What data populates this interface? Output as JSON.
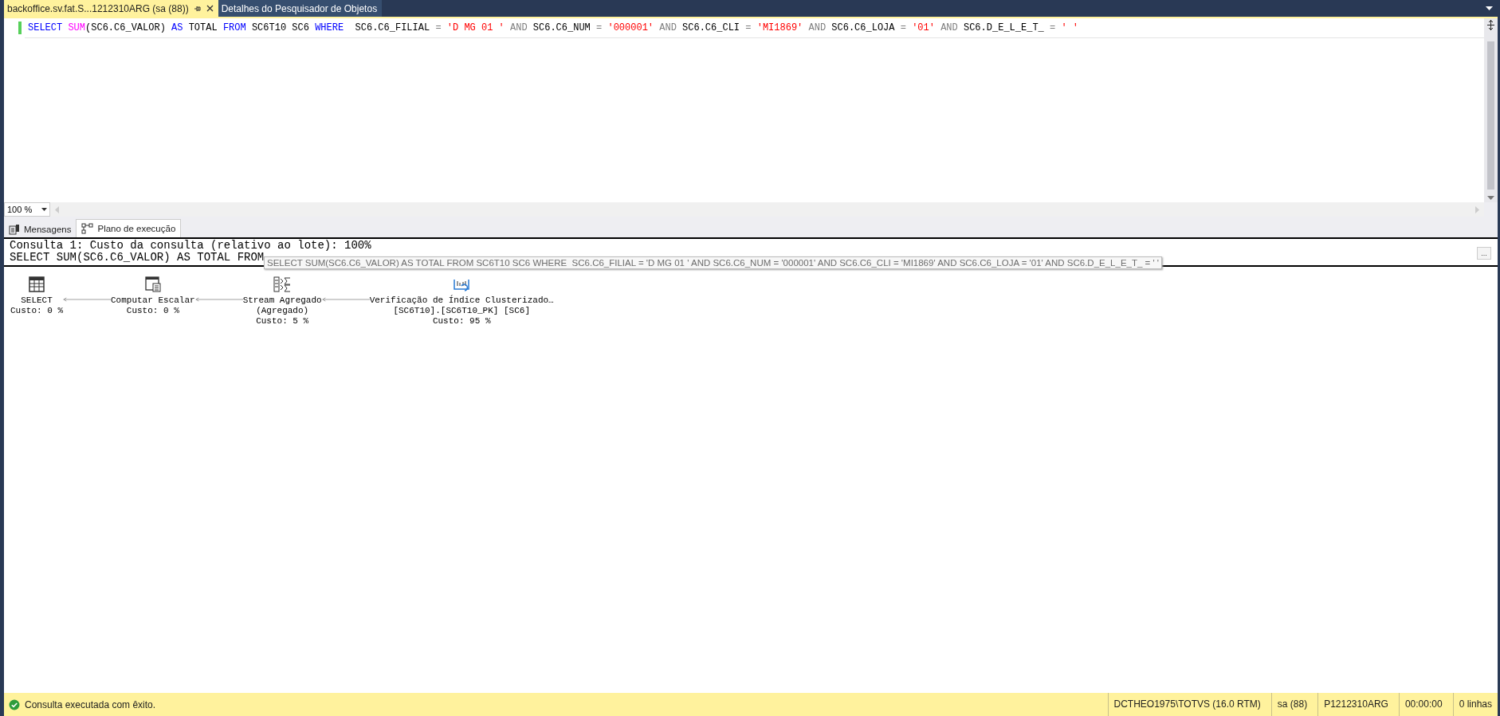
{
  "tabs": [
    {
      "label": "backoffice.sv.fat.S...1212310ARG (sa (88))",
      "selected": true
    },
    {
      "label": "Detalhes do Pesquisador de Objetos",
      "selected": false
    }
  ],
  "editor": {
    "tokens": [
      {
        "text": "SELECT ",
        "kind": "kw"
      },
      {
        "text": "SUM",
        "kind": "fn"
      },
      {
        "text": "(SC6.C6_VALOR) ",
        "kind": "plain"
      },
      {
        "text": "AS ",
        "kind": "kw"
      },
      {
        "text": "TOTAL ",
        "kind": "plain"
      },
      {
        "text": "FROM ",
        "kind": "kw"
      },
      {
        "text": "SC6T10 SC6 ",
        "kind": "plain"
      },
      {
        "text": "WHERE ",
        "kind": "kw"
      },
      {
        "text": " SC6.C6_FILIAL ",
        "kind": "plain"
      },
      {
        "text": "= ",
        "kind": "op"
      },
      {
        "text": "'D MG 01 '",
        "kind": "str"
      },
      {
        "text": " AND ",
        "kind": "op"
      },
      {
        "text": "SC6.C6_NUM ",
        "kind": "plain"
      },
      {
        "text": "= ",
        "kind": "op"
      },
      {
        "text": "'000001'",
        "kind": "str"
      },
      {
        "text": " AND ",
        "kind": "op"
      },
      {
        "text": "SC6.C6_CLI ",
        "kind": "plain"
      },
      {
        "text": "= ",
        "kind": "op"
      },
      {
        "text": "'MI1869'",
        "kind": "str"
      },
      {
        "text": " AND ",
        "kind": "op"
      },
      {
        "text": "SC6.C6_LOJA ",
        "kind": "plain"
      },
      {
        "text": "= ",
        "kind": "op"
      },
      {
        "text": "'01'",
        "kind": "str"
      },
      {
        "text": " AND ",
        "kind": "op"
      },
      {
        "text": "SC6.D_E_L_E_T_ ",
        "kind": "plain"
      },
      {
        "text": "= ",
        "kind": "op"
      },
      {
        "text": "' '",
        "kind": "str"
      }
    ]
  },
  "zoom": "100 %",
  "result_tabs": [
    {
      "label": "Mensagens",
      "kind": "messages",
      "selected": false
    },
    {
      "label": "Plano de execução",
      "kind": "plan",
      "selected": true
    }
  ],
  "plan": {
    "header": "Consulta 1: Custo da consulta (relativo ao lote): 100%",
    "query": "SELECT SUM(SC6.C6_VALOR) AS TOTAL FROM",
    "tooltip": "SELECT SUM(SC6.C6_VALOR) AS TOTAL FROM SC6T10 SC6 WHERE  SC6.C6_FILIAL = 'D MG 01 ' AND SC6.C6_NUM = '000001' AND SC6.C6_CLI = 'MI1869' AND SC6.C6_LOJA = '01' AND SC6.D_E_L_E_T_ = ' '",
    "more_button": "...",
    "nodes": [
      {
        "kind": "select",
        "lines": [
          "SELECT"
        ],
        "cost": "Custo: 0 %"
      },
      {
        "kind": "scalar",
        "lines": [
          "Computar Escalar"
        ],
        "cost": "Custo: 0 %"
      },
      {
        "kind": "aggregate",
        "lines": [
          "Stream Agregado",
          "(Agregado)"
        ],
        "cost": "Custo: 5 %"
      },
      {
        "kind": "scan",
        "lines": [
          "Verificação de Índice Clusterizado…",
          "[SC6T10].[SC6T10_PK] [SC6]"
        ],
        "cost": "Custo: 95 %"
      }
    ]
  },
  "status_bar": {
    "message": "Consulta executada com êxito.",
    "sections": [
      "DCTHEO1975\\TOTVS (16.0 RTM)",
      "sa (88)",
      "P1212310ARG",
      "00:00:00",
      "0 linhas"
    ]
  }
}
